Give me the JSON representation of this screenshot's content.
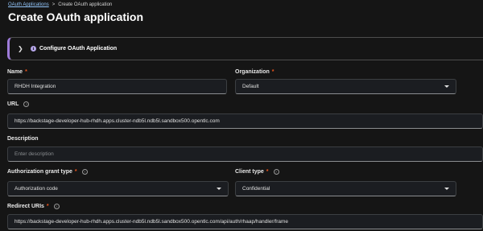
{
  "breadcrumb": {
    "parent": "OAuth Applications",
    "separator": ">",
    "current": "Create OAuth application"
  },
  "page_title": "Create OAuth application",
  "section": {
    "label": "Configure OAuth Application",
    "icon": "info-icon",
    "accent": "#9e7bd9"
  },
  "fields": {
    "name": {
      "label": "Name",
      "required": "*",
      "value": "RHDH Integration"
    },
    "organization": {
      "label": "Organization",
      "required": "*",
      "value": "Default"
    },
    "url": {
      "label": "URL",
      "value": "https://backstage-developer-hub-rhdh.apps.cluster-ndb5l.ndb5l.sandbox500.opentlc.com"
    },
    "description": {
      "label": "Description",
      "placeholder": "Enter description"
    },
    "grant_type": {
      "label": "Authorization grant type",
      "required": "*",
      "value": "Authorization code"
    },
    "client_type": {
      "label": "Client type",
      "required": "*",
      "value": "Confidential"
    },
    "redirect_uris": {
      "label": "Redirect URIs",
      "required": "*",
      "value": "https://backstage-developer-hub-rhdh.apps.cluster-ndb5l.ndb5l.sandbox500.opentlc.com/api/auth/rhaap/handler/frame"
    }
  },
  "colors": {
    "background": "#151515",
    "link": "#92c5f9",
    "required": "#f0561d"
  }
}
